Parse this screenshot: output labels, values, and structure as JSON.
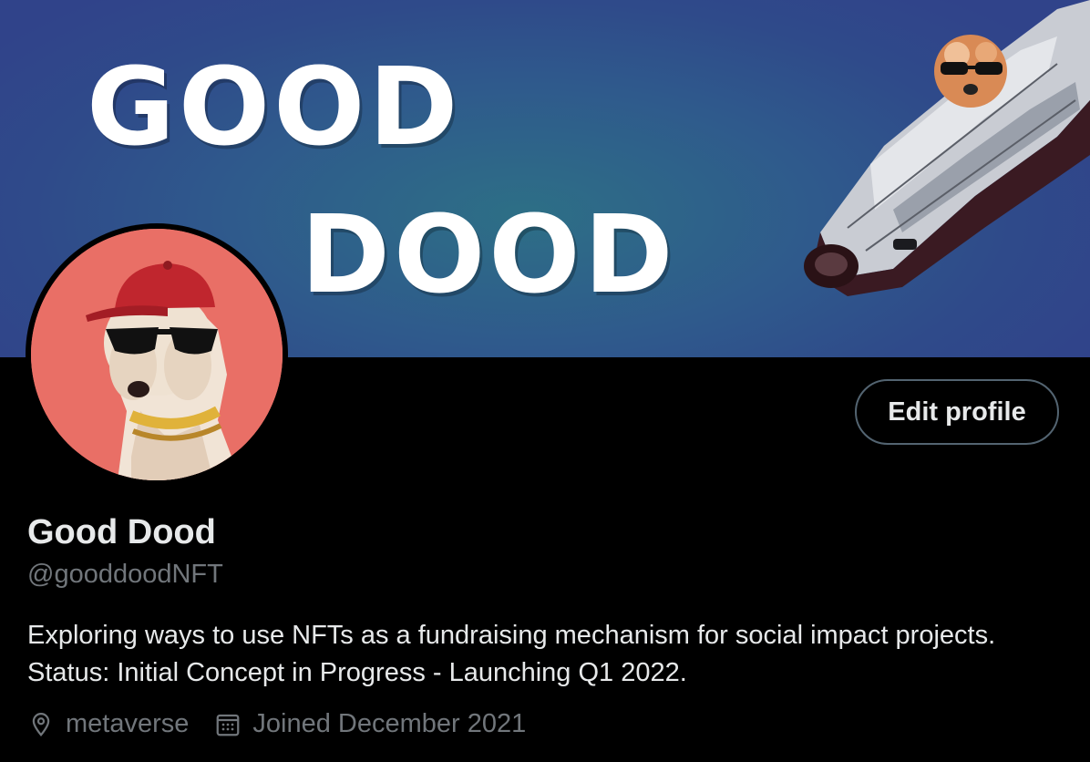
{
  "banner": {
    "line1": "GOOD",
    "line2": "DOOD"
  },
  "profile": {
    "display_name": "Good Dood",
    "handle": "@gooddoodNFT",
    "bio_line1": "Exploring ways to use NFTs as a fundraising mechanism for social impact projects.",
    "bio_line2": "Status: Initial Concept in Progress - Launching Q1 2022.",
    "location": "metaverse",
    "joined": "Joined December 2021",
    "location_icon": "location-pin-icon",
    "joined_icon": "calendar-icon"
  },
  "actions": {
    "edit_profile_label": "Edit profile"
  },
  "colors": {
    "background": "#000000",
    "text_primary": "#e7e9ea",
    "text_secondary": "#71767b",
    "button_border": "#536471",
    "avatar_bg": "#e96f66",
    "banner_blue": "#2f4a8a"
  }
}
